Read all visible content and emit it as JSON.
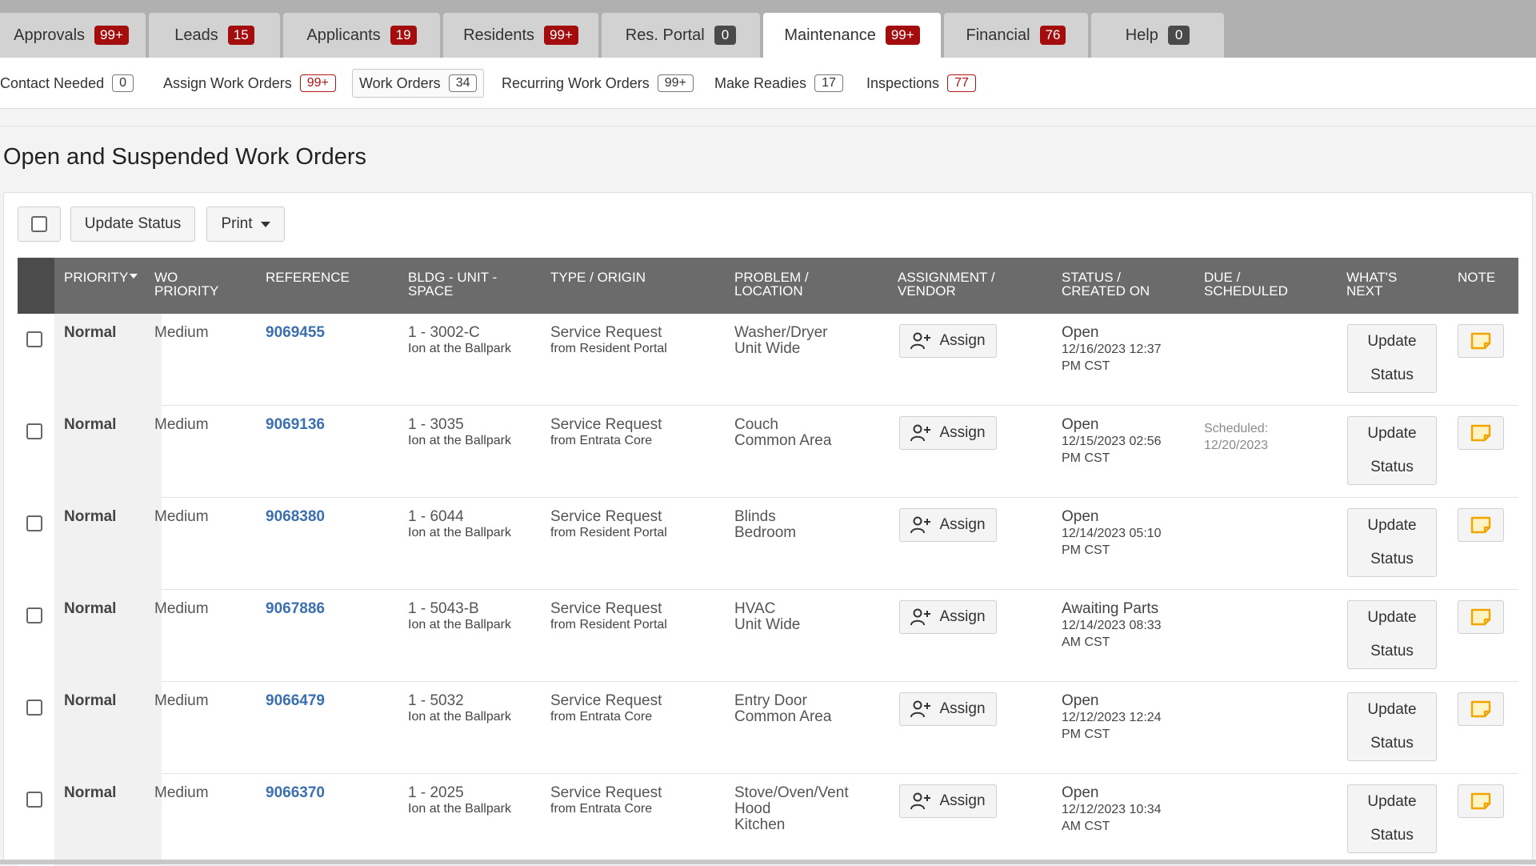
{
  "top_tabs": [
    {
      "label": "Approvals",
      "count": "99+",
      "style": "red"
    },
    {
      "label": "Leads",
      "count": "15",
      "style": "red"
    },
    {
      "label": "Applicants",
      "count": "19",
      "style": "red"
    },
    {
      "label": "Residents",
      "count": "99+",
      "style": "red"
    },
    {
      "label": "Res. Portal",
      "count": "0",
      "style": "dark"
    },
    {
      "label": "Maintenance",
      "count": "99+",
      "style": "red",
      "active": true
    },
    {
      "label": "Financial",
      "count": "76",
      "style": "red"
    },
    {
      "label": "Help",
      "count": "0",
      "style": "dark"
    }
  ],
  "sub_tabs": [
    {
      "label": "Contact Needed",
      "count": "0",
      "style": "gray"
    },
    {
      "label": "Assign Work Orders",
      "count": "99+",
      "style": "red"
    },
    {
      "label": "Work Orders",
      "count": "34",
      "style": "gray",
      "active": true
    },
    {
      "label": "Recurring Work Orders",
      "count": "99+",
      "style": "gray"
    },
    {
      "label": "Make Readies",
      "count": "17",
      "style": "gray"
    },
    {
      "label": "Inspections",
      "count": "77",
      "style": "red"
    }
  ],
  "page_title": "Open and Suspended Work Orders",
  "toolbar": {
    "update_status_label": "Update Status",
    "print_label": "Print"
  },
  "columns": {
    "priority": "PRIORITY",
    "wo_priority_1": "WO",
    "wo_priority_2": "PRIORITY",
    "reference": "REFERENCE",
    "bldg_1": "BLDG - UNIT -",
    "bldg_2": "SPACE",
    "type": "TYPE / ORIGIN",
    "problem_1": "PROBLEM /",
    "problem_2": "LOCATION",
    "assign_1": "ASSIGNMENT /",
    "assign_2": "VENDOR",
    "status_1": "STATUS /",
    "status_2": "CREATED ON",
    "due_1": "DUE /",
    "due_2": "SCHEDULED",
    "next_1": "WHAT'S",
    "next_2": "NEXT",
    "note": "NOTE"
  },
  "rows": [
    {
      "priority": "Normal",
      "wo_priority": "Medium",
      "reference": "9069455",
      "unit": "1 - 3002-C",
      "property": "Ion at the Ballpark",
      "type": "Service Request",
      "origin": "from Resident Portal",
      "problem": "Washer/Dryer",
      "location": "Unit Wide",
      "location2": "",
      "status": "Open",
      "created_1": "12/16/2023 12:37",
      "created_2": "PM CST",
      "sched_1": "",
      "sched_2": ""
    },
    {
      "priority": "Normal",
      "wo_priority": "Medium",
      "reference": "9069136",
      "unit": "1 - 3035",
      "property": "Ion at the Ballpark",
      "type": "Service Request",
      "origin": "from Entrata Core",
      "problem": "Couch",
      "location": "Common Area",
      "location2": "",
      "status": "Open",
      "created_1": "12/15/2023 02:56",
      "created_2": "PM CST",
      "sched_1": "Scheduled:",
      "sched_2": "12/20/2023"
    },
    {
      "priority": "Normal",
      "wo_priority": "Medium",
      "reference": "9068380",
      "unit": "1 - 6044",
      "property": "Ion at the Ballpark",
      "type": "Service Request",
      "origin": "from Resident Portal",
      "problem": "Blinds",
      "location": "Bedroom",
      "location2": "",
      "status": "Open",
      "created_1": "12/14/2023 05:10",
      "created_2": "PM CST",
      "sched_1": "",
      "sched_2": ""
    },
    {
      "priority": "Normal",
      "wo_priority": "Medium",
      "reference": "9067886",
      "unit": "1 - 5043-B",
      "property": "Ion at the Ballpark",
      "type": "Service Request",
      "origin": "from Resident Portal",
      "problem": "HVAC",
      "location": "Unit Wide",
      "location2": "",
      "status": "Awaiting Parts",
      "created_1": "12/14/2023 08:33",
      "created_2": "AM CST",
      "sched_1": "",
      "sched_2": ""
    },
    {
      "priority": "Normal",
      "wo_priority": "Medium",
      "reference": "9066479",
      "unit": "1 - 5032",
      "property": "Ion at the Ballpark",
      "type": "Service Request",
      "origin": "from Entrata Core",
      "problem": "Entry Door",
      "location": "Common Area",
      "location2": "",
      "status": "Open",
      "created_1": "12/12/2023 12:24",
      "created_2": "PM CST",
      "sched_1": "",
      "sched_2": ""
    },
    {
      "priority": "Normal",
      "wo_priority": "Medium",
      "reference": "9066370",
      "unit": "1 - 2025",
      "property": "Ion at the Ballpark",
      "type": "Service Request",
      "origin": "from Entrata Core",
      "problem": "Stove/Oven/Vent",
      "location": "Hood",
      "location2": "Kitchen",
      "status": "Open",
      "created_1": "12/12/2023 10:34",
      "created_2": "AM CST",
      "sched_1": "",
      "sched_2": ""
    }
  ],
  "row_actions": {
    "assign_label": "Assign",
    "update_1": "Update",
    "update_2": "Status"
  },
  "icons": {
    "assign": "add-user-icon",
    "note": "sticky-note-icon"
  },
  "colors": {
    "badge_red": "#a30d0d",
    "link_blue": "#3a6fb0",
    "note_orange": "#f0a500",
    "header_gray": "#6b6b6b"
  }
}
